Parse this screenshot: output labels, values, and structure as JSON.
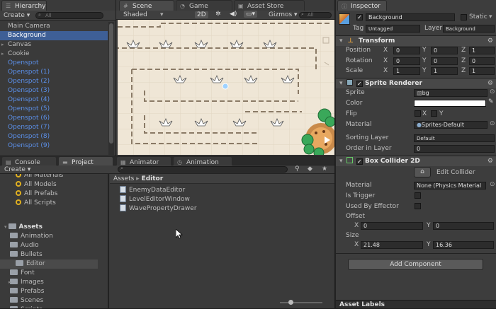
{
  "hierarchy": {
    "tab": "Hierarchy",
    "create": "Create",
    "search_placeholder": "All",
    "items": [
      {
        "label": "Main Camera",
        "blue": false,
        "fold": false
      },
      {
        "label": "Background",
        "blue": false,
        "fold": false,
        "selected": true
      },
      {
        "label": "Canvas",
        "blue": false,
        "fold": true
      },
      {
        "label": "Cookie",
        "blue": false,
        "fold": true
      },
      {
        "label": "Openspot",
        "blue": true
      },
      {
        "label": "Openspot (1)",
        "blue": true
      },
      {
        "label": "Openspot (2)",
        "blue": true
      },
      {
        "label": "Openspot (3)",
        "blue": true
      },
      {
        "label": "Openspot (4)",
        "blue": true
      },
      {
        "label": "Openspot (5)",
        "blue": true
      },
      {
        "label": "Openspot (6)",
        "blue": true
      },
      {
        "label": "Openspot (7)",
        "blue": true
      },
      {
        "label": "Openspot (8)",
        "blue": true
      },
      {
        "label": "Openspot (9)",
        "blue": true
      }
    ]
  },
  "scene": {
    "tabs": [
      "Scene",
      "Game",
      "Asset Store"
    ],
    "shading": "Shaded",
    "mode": "2D",
    "gizmos": "Gizmos",
    "search_placeholder": "All"
  },
  "bottom_tabs": {
    "console": "Console",
    "project": "Project",
    "animator": "Animator",
    "animation": "Animation"
  },
  "project": {
    "create": "Create",
    "favorites": [
      "All Materials",
      "All Models",
      "All Prefabs",
      "All Scripts"
    ],
    "assets_root": "Assets",
    "folders": [
      "Animation",
      "Audio",
      "Bullets",
      "Editor",
      "Font",
      "Images",
      "Prefabs",
      "Scenes",
      "Scripts"
    ],
    "breadcrumb": [
      "Assets",
      "Editor"
    ],
    "files": [
      "EnemyDataEditor",
      "LevelEditorWindow",
      "WavePropertyDrawer"
    ]
  },
  "inspector": {
    "tab": "Inspector",
    "object_name": "Background",
    "static_label": "Static",
    "tag_label": "Tag",
    "tag_value": "Untagged",
    "layer_label": "Layer",
    "layer_value": "Background",
    "transform": {
      "title": "Transform",
      "position": {
        "label": "Position",
        "x": "0",
        "y": "0",
        "z": "1"
      },
      "rotation": {
        "label": "Rotation",
        "x": "0",
        "y": "0",
        "z": "0"
      },
      "scale": {
        "label": "Scale",
        "x": "1",
        "y": "1",
        "z": "1"
      }
    },
    "sprite_renderer": {
      "title": "Sprite Renderer",
      "sprite_label": "Sprite",
      "sprite_value": "bg",
      "color_label": "Color",
      "flip_label": "Flip",
      "flip_x": "X",
      "flip_y": "Y",
      "material_label": "Material",
      "material_value": "Sprites-Default",
      "sorting_label": "Sorting Layer",
      "sorting_value": "Default",
      "order_label": "Order in Layer",
      "order_value": "0"
    },
    "box_collider": {
      "title": "Box Collider 2D",
      "edit_label": "Edit Collider",
      "material_label": "Material",
      "material_value": "None (Physics Material",
      "trigger_label": "Is Trigger",
      "effector_label": "Used By Effector",
      "offset_label": "Offset",
      "offset_x": "0",
      "offset_y": "0",
      "size_label": "Size",
      "size_x": "21.48",
      "size_y": "16.36"
    },
    "add_component": "Add Component",
    "asset_labels": "Asset Labels"
  }
}
